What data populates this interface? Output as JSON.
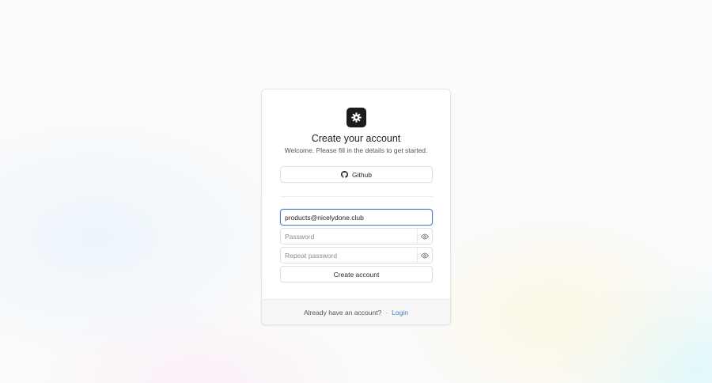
{
  "header": {
    "logo_icon": "gear-icon",
    "title": "Create your account",
    "subtitle": "Welcome. Please fill in the details to get started."
  },
  "oauth": {
    "github_label": "Github",
    "github_icon": "github-icon"
  },
  "form": {
    "email_value": "products@nicelydone.club",
    "password_placeholder": "Password",
    "repeat_password_placeholder": "Repeat password",
    "toggle_icon": "eye-icon",
    "submit_label": "Create account"
  },
  "footer": {
    "prompt": "Already have an account?",
    "separator": "·",
    "login_label": "Login"
  },
  "colors": {
    "focus_border": "#4f7fc0",
    "link": "#3b82c4",
    "logo_bg": "#1c1c1e"
  }
}
